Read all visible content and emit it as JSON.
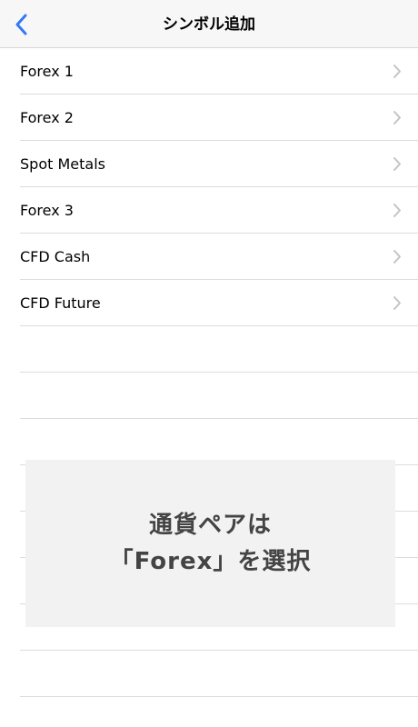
{
  "nav": {
    "title": "シンボル追加",
    "back_icon": "chevron-left-icon"
  },
  "colors": {
    "accent": "#3478f6",
    "chevron": "#c4c4c7",
    "separator": "#dcdcdf"
  },
  "list": {
    "items": [
      {
        "label": "Forex 1",
        "icon": "chevron-right-icon"
      },
      {
        "label": "Forex 2",
        "icon": "chevron-right-icon"
      },
      {
        "label": "Spot Metals",
        "icon": "chevron-right-icon"
      },
      {
        "label": "Forex 3",
        "icon": "chevron-right-icon"
      },
      {
        "label": "CFD Cash",
        "icon": "chevron-right-icon"
      },
      {
        "label": "CFD Future",
        "icon": "chevron-right-icon"
      }
    ]
  },
  "annotation": {
    "line1": "通貨ペアは",
    "line2": "「Forex」を選択"
  }
}
